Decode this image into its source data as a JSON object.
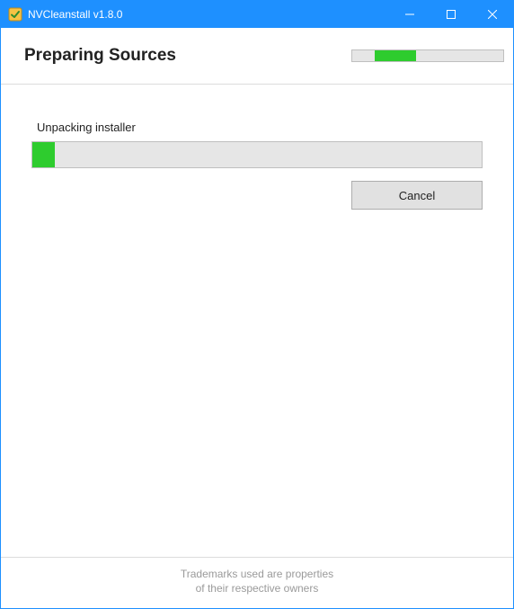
{
  "titlebar": {
    "title": "NVCleanstall v1.8.0"
  },
  "header": {
    "heading": "Preparing Sources",
    "top_progress_start_pct": 15,
    "top_progress_width_pct": 27
  },
  "body": {
    "status_text": "Unpacking installer",
    "progress_pct": 5,
    "cancel_label": "Cancel"
  },
  "footer": {
    "line1": "Trademarks used are properties",
    "line2": "of their respective owners"
  }
}
